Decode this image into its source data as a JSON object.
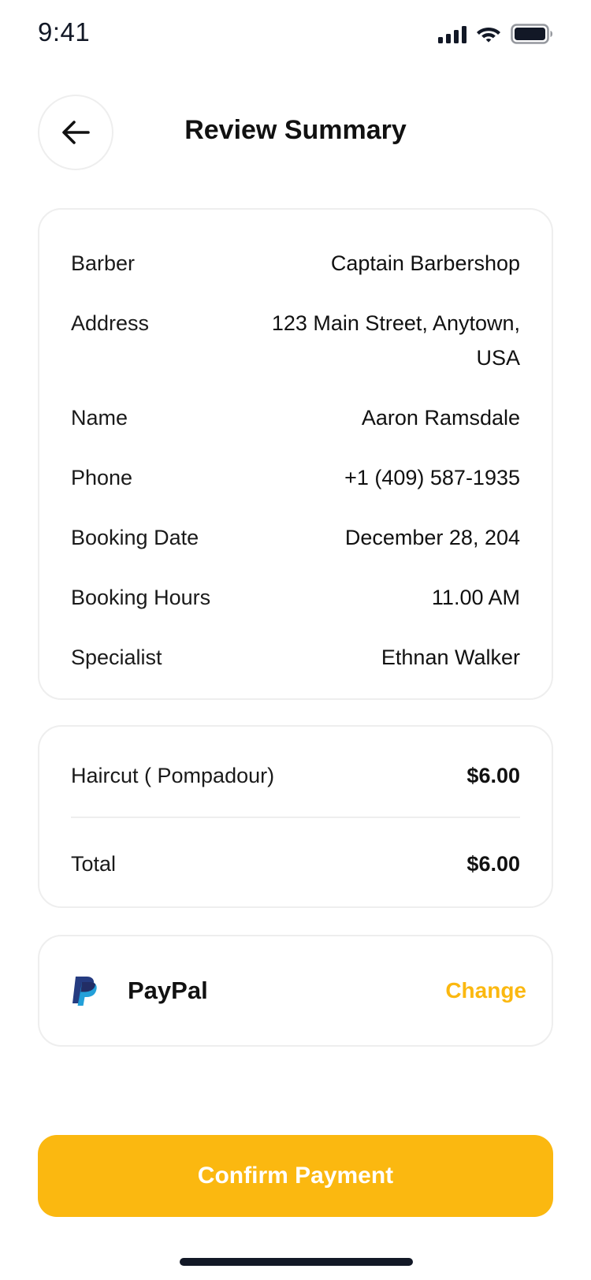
{
  "status_bar": {
    "time": "9:41"
  },
  "header": {
    "title": "Review Summary",
    "back_icon": "arrow-left-icon"
  },
  "details": [
    {
      "label": "Barber",
      "value": "Captain Barbershop"
    },
    {
      "label": "Address",
      "value": "123 Main Street, Anytown, USA"
    },
    {
      "label": "Name",
      "value": "Aaron Ramsdale"
    },
    {
      "label": "Phone",
      "value": "+1 (409) 587-1935"
    },
    {
      "label": "Booking Date",
      "value": "December 28, 204"
    },
    {
      "label": "Booking Hours",
      "value": "11.00 AM"
    },
    {
      "label": "Specialist",
      "value": "Ethnan Walker"
    }
  ],
  "pricing": {
    "item": {
      "label": "Haircut ( Pompadour)",
      "value": "$6.00"
    },
    "total": {
      "label": "Total",
      "value": "$6.00"
    }
  },
  "payment": {
    "method": "PayPal",
    "icon": "paypal-icon",
    "change_label": "Change"
  },
  "confirm_label": "Confirm Payment",
  "colors": {
    "accent": "#FBB810",
    "border": "#EEEEEE",
    "text": "#111111",
    "paypal_dark": "#253B80",
    "paypal_light": "#179BD7"
  }
}
